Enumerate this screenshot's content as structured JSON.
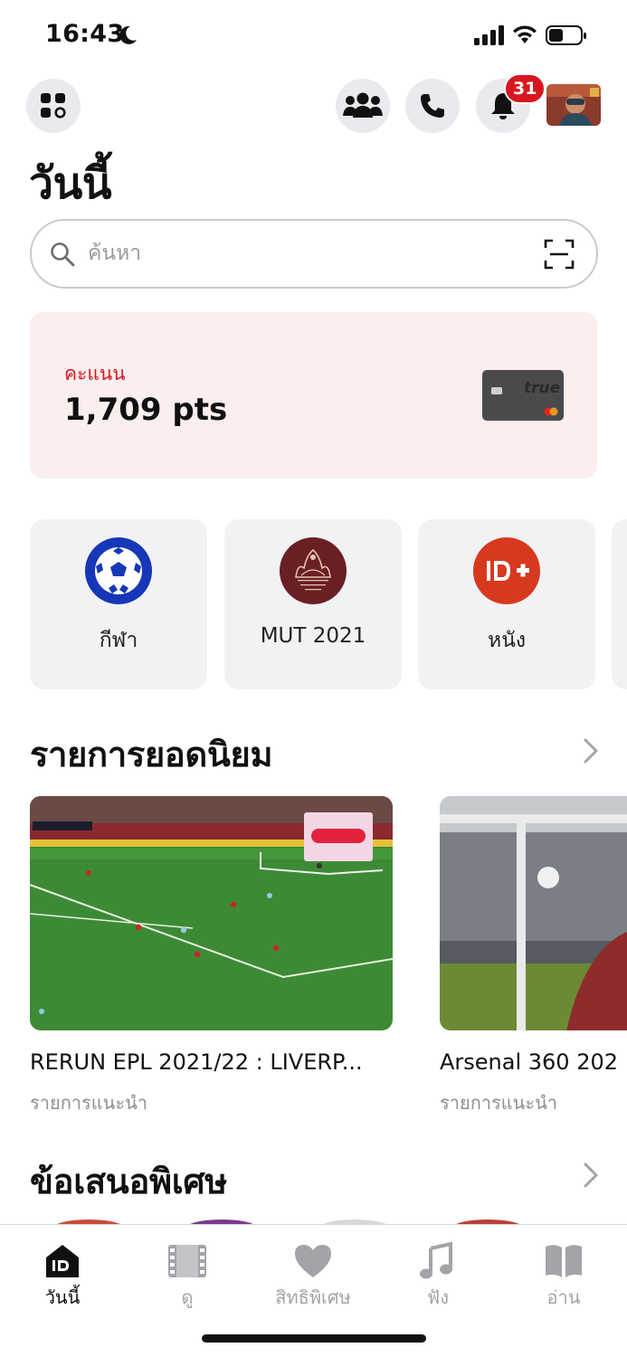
{
  "status_bar": {
    "time": "16:43"
  },
  "header": {
    "notification_count": "31"
  },
  "page": {
    "title": "วันนี้"
  },
  "search": {
    "placeholder": "ค้นหา"
  },
  "points": {
    "label": "คะแนน",
    "value": "1,709 pts",
    "card_brand": "true"
  },
  "categories": [
    {
      "label": "กีฬา",
      "icon": "soccer-ball-icon",
      "color": "#1637b8"
    },
    {
      "label": "MUT 2021",
      "icon": "miss-universe-logo",
      "color": "#6a1f25"
    },
    {
      "label": "หนัง",
      "icon": "trueid-plus-logo",
      "color": "#d6391e"
    }
  ],
  "popular": {
    "title": "รายการยอดนิยม",
    "items": [
      {
        "title": "RERUN EPL 2021/22 : LIVERP...",
        "subtitle": "รายการแนะนำ"
      },
      {
        "title": "Arsenal 360 202",
        "subtitle": "รายการแนะนำ"
      }
    ]
  },
  "offers": {
    "title": "ข้อเสนอพิเศษ"
  },
  "tabs": [
    {
      "label": "วันนี้",
      "icon": "trueid-home-icon",
      "active": true
    },
    {
      "label": "ดู",
      "icon": "film-icon",
      "active": false
    },
    {
      "label": "สิทธิพิเศษ",
      "icon": "heart-icon",
      "active": false
    },
    {
      "label": "ฟัง",
      "icon": "music-note-icon",
      "active": false
    },
    {
      "label": "อ่าน",
      "icon": "book-icon",
      "active": false
    }
  ],
  "colors": {
    "accent": "#d8161f",
    "points_bg": "#faeeee",
    "tile_bg": "#f2f2f4"
  }
}
